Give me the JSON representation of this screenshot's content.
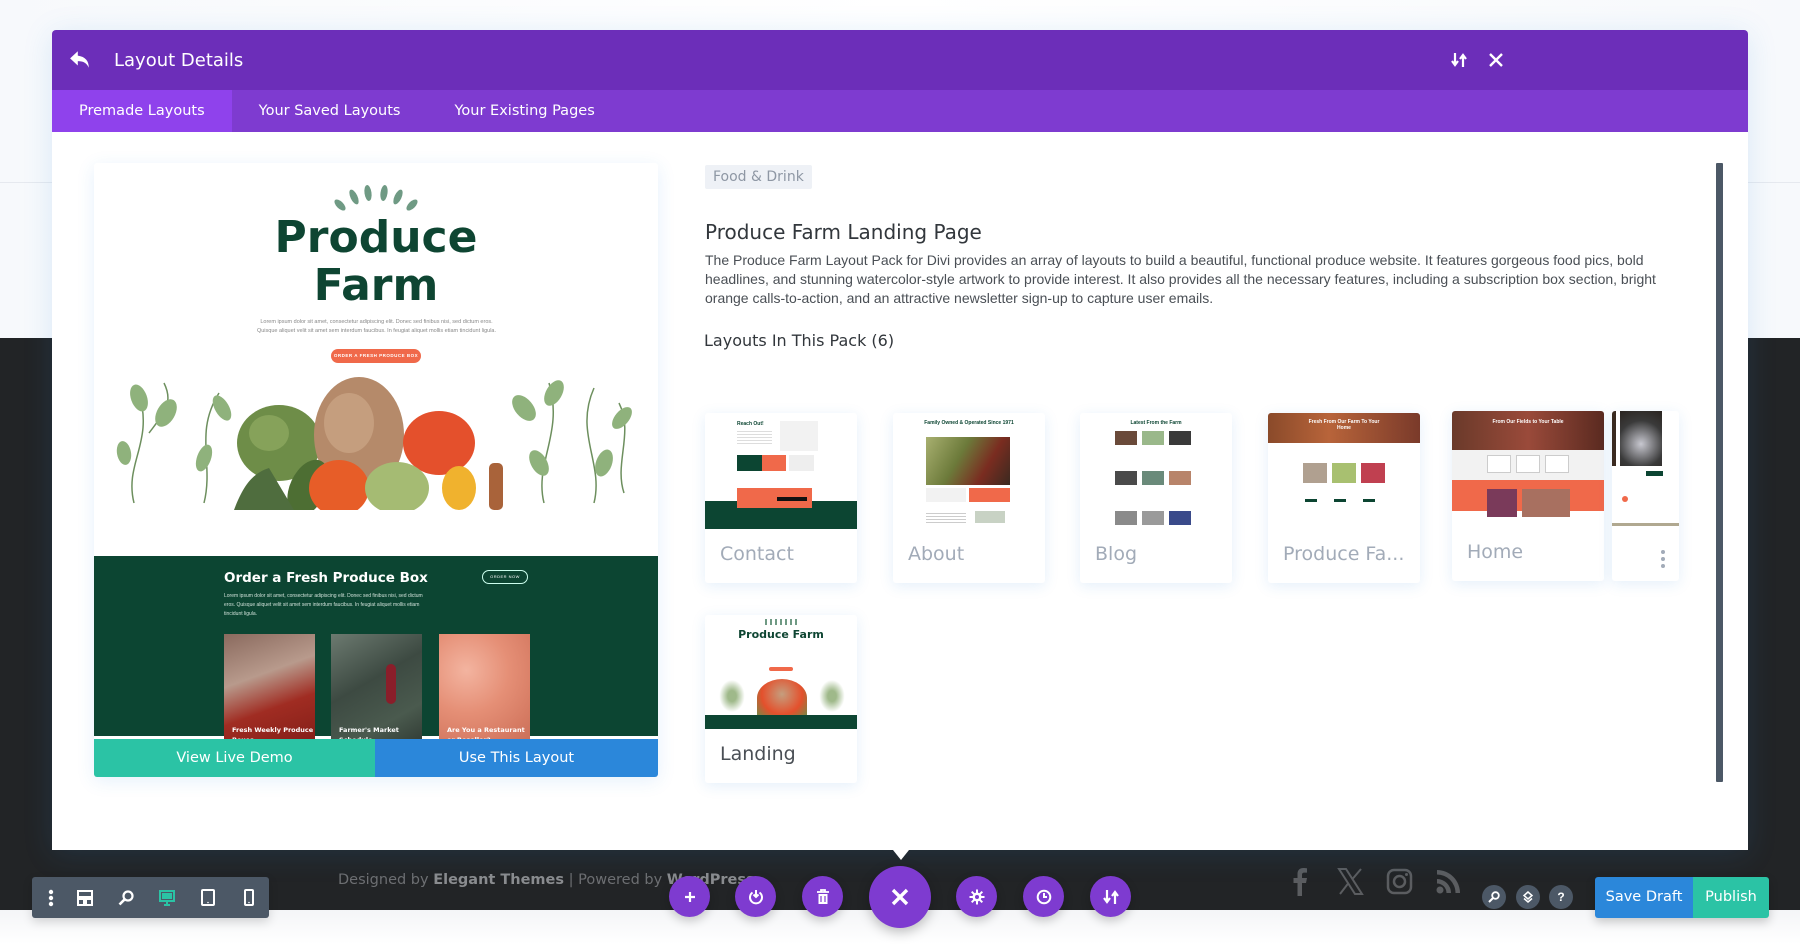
{
  "modal": {
    "title": "Layout Details",
    "tabs": [
      {
        "label": "Premade Layouts",
        "active": true
      },
      {
        "label": "Your Saved Layouts",
        "active": false
      },
      {
        "label": "Your Existing Pages",
        "active": false
      }
    ]
  },
  "preview": {
    "title_line1": "Produce",
    "title_line2": "Farm",
    "lorem": "Lorem ipsum dolor sit amet, consectetur adipiscing elit. Donec sed finibus nisi, sed dictum eros. Quisque aliquet velit sit amet sem interdum faucibus. In feugiat aliquet mollis etiam tincidunt ligula.",
    "cta": "ORDER A FRESH PRODUCE BOX",
    "section_title": "Order a Fresh Produce Box",
    "order_now": "ORDER NOW",
    "section_lorem": "Lorem ipsum dolor sit amet, consectetur adipiscing elit. Donec sed finibus nisi, sed dictum eros. Quisque aliquet velit sit amet sem interdum faucibus. In feugiat aliquet mollis etiam tincidunt ligula.",
    "photos": [
      {
        "caption": "Fresh Weekly Produce Boxes"
      },
      {
        "caption": "Farmer's Market Schedule"
      },
      {
        "caption": "Are You a Restaurant or Reseller?"
      }
    ],
    "view_demo_label": "View Live Demo",
    "use_layout_label": "Use This Layout"
  },
  "pack": {
    "category": "Food & Drink",
    "title": "Produce Farm Landing Page",
    "description": "The Produce Farm Layout Pack for Divi provides an array of layouts to build a beautiful, functional produce website. It features gorgeous food pics, bold headlines, and stunning watercolor-style artwork to provide interest. It also provides all the necessary features, including a subscription box section, bright orange calls-to-action, and an attractive newsletter sign-up to capture user emails.",
    "layouts_heading": "Layouts In This Pack (6)",
    "layouts": [
      {
        "name": "Contact",
        "thumb_heading": "Reach Out!"
      },
      {
        "name": "About",
        "thumb_heading": "Family Owned & Operated Since 1971"
      },
      {
        "name": "Blog",
        "thumb_heading": "Latest From the Farm"
      },
      {
        "name": "Produce Fa...",
        "thumb_heading": "Fresh From Our Farm To Your Home"
      },
      {
        "name": "Home",
        "thumb_heading": "From Our Fields to Your Table"
      },
      {
        "name": "Landing",
        "thumb_heading": "Produce Farm"
      }
    ]
  },
  "footer": {
    "designed_by": "Designed by",
    "elegant_themes": "Elegant Themes",
    "separator": "|",
    "powered_by": "Powered by",
    "wordpress": "WordPress"
  },
  "toolbar": {
    "save_draft": "Save Draft",
    "publish": "Publish",
    "help": "?"
  },
  "colors": {
    "header": "#6c2eb9",
    "tabs": "#7e3bd0",
    "active_tab": "#8f42ec",
    "teal": "#2bc3a5",
    "blue": "#2b87da",
    "farm_green": "#0c4532",
    "orange": "#f0694a",
    "toolbar_gray": "#4c5866"
  }
}
